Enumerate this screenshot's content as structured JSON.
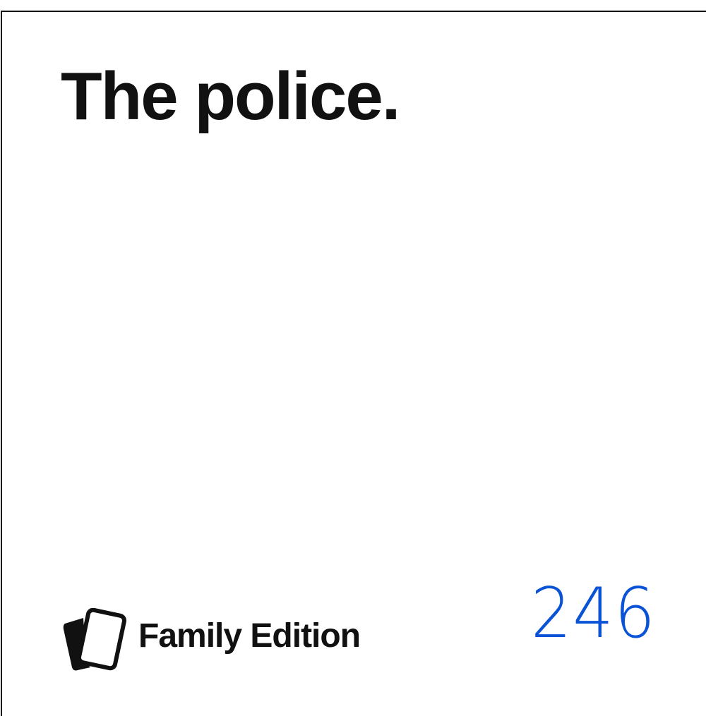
{
  "card": {
    "title": "The police.",
    "brand": "Family Edition",
    "number": "246",
    "number_color": "#0a52d6",
    "logo_icon": "cards-icon"
  }
}
